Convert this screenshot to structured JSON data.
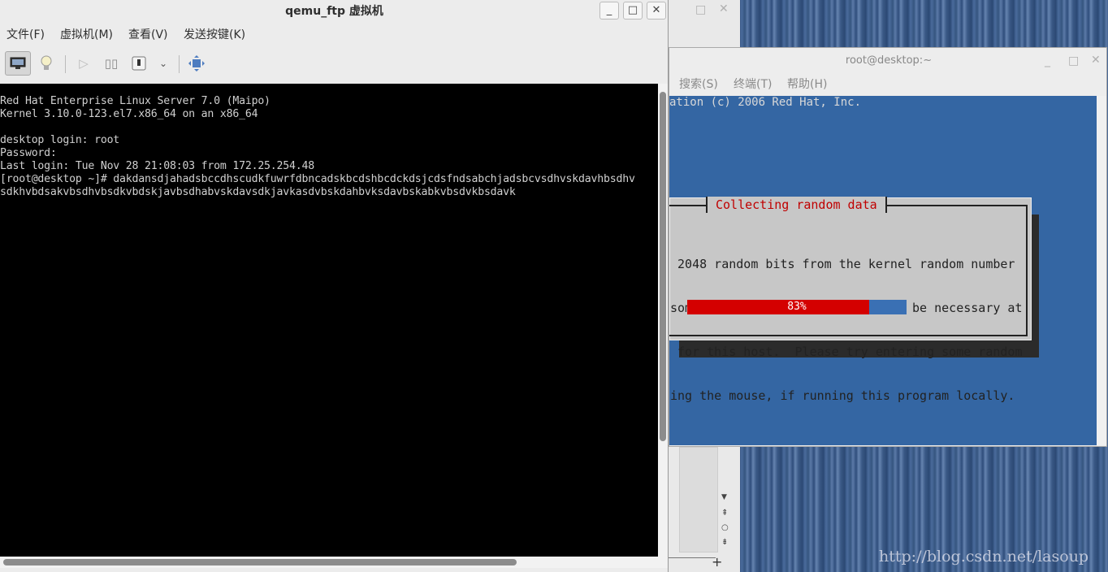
{
  "qemu_window": {
    "title": "qemu_ftp 虚拟机",
    "menu": [
      "文件(F)",
      "虚拟机(M)",
      "查看(V)",
      "发送按键(K)"
    ],
    "controls": {
      "minimize": "_",
      "maximize": "□",
      "close": "✕"
    },
    "console_lines": [
      "Red Hat Enterprise Linux Server 7.0 (Maipo)",
      "Kernel 3.10.0-123.el7.x86_64 on an x86_64",
      "",
      "desktop login: root",
      "Password:",
      "Last login: Tue Nov 28 21:08:03 from 172.25.254.48",
      "[root@desktop ~]# dakdansdjahadsbccdhscudkfuwrfdbncadskbcdshbcdckdsjcdsfndsabchjadsbcvsdhvskdavhbsdhv",
      "sdkhvbdsakvbsdhvbsdkvbdskjavbsdhabvskdavsdkjavkasdvbskdahbvksdavbskabkvbsdvkbsdavk"
    ]
  },
  "terminal_window": {
    "title": "root@desktop:~",
    "menu": [
      "搜索(S)",
      "终端(T)",
      "帮助(H)"
    ],
    "copyright_fragment": "ation (c) 2006 Red Hat, Inc.",
    "dialog": {
      "title": "Collecting random data",
      "text_lines": [
        " 2048 random bits from the kernel random number",
        "some keyboard or mouse input may be necessary at",
        " for this host.  Please try entering some random",
        "ing the mouse, if running this program locally."
      ],
      "progress_label": "83%",
      "progress_fraction": 0.83
    }
  },
  "watermark": "http://blog.csdn.net/lasoup",
  "colors": {
    "terminal_bg": "#3466a3",
    "dialog_title": "#c00000",
    "progress_fill": "#d40000",
    "progress_track": "#3a70b4"
  }
}
